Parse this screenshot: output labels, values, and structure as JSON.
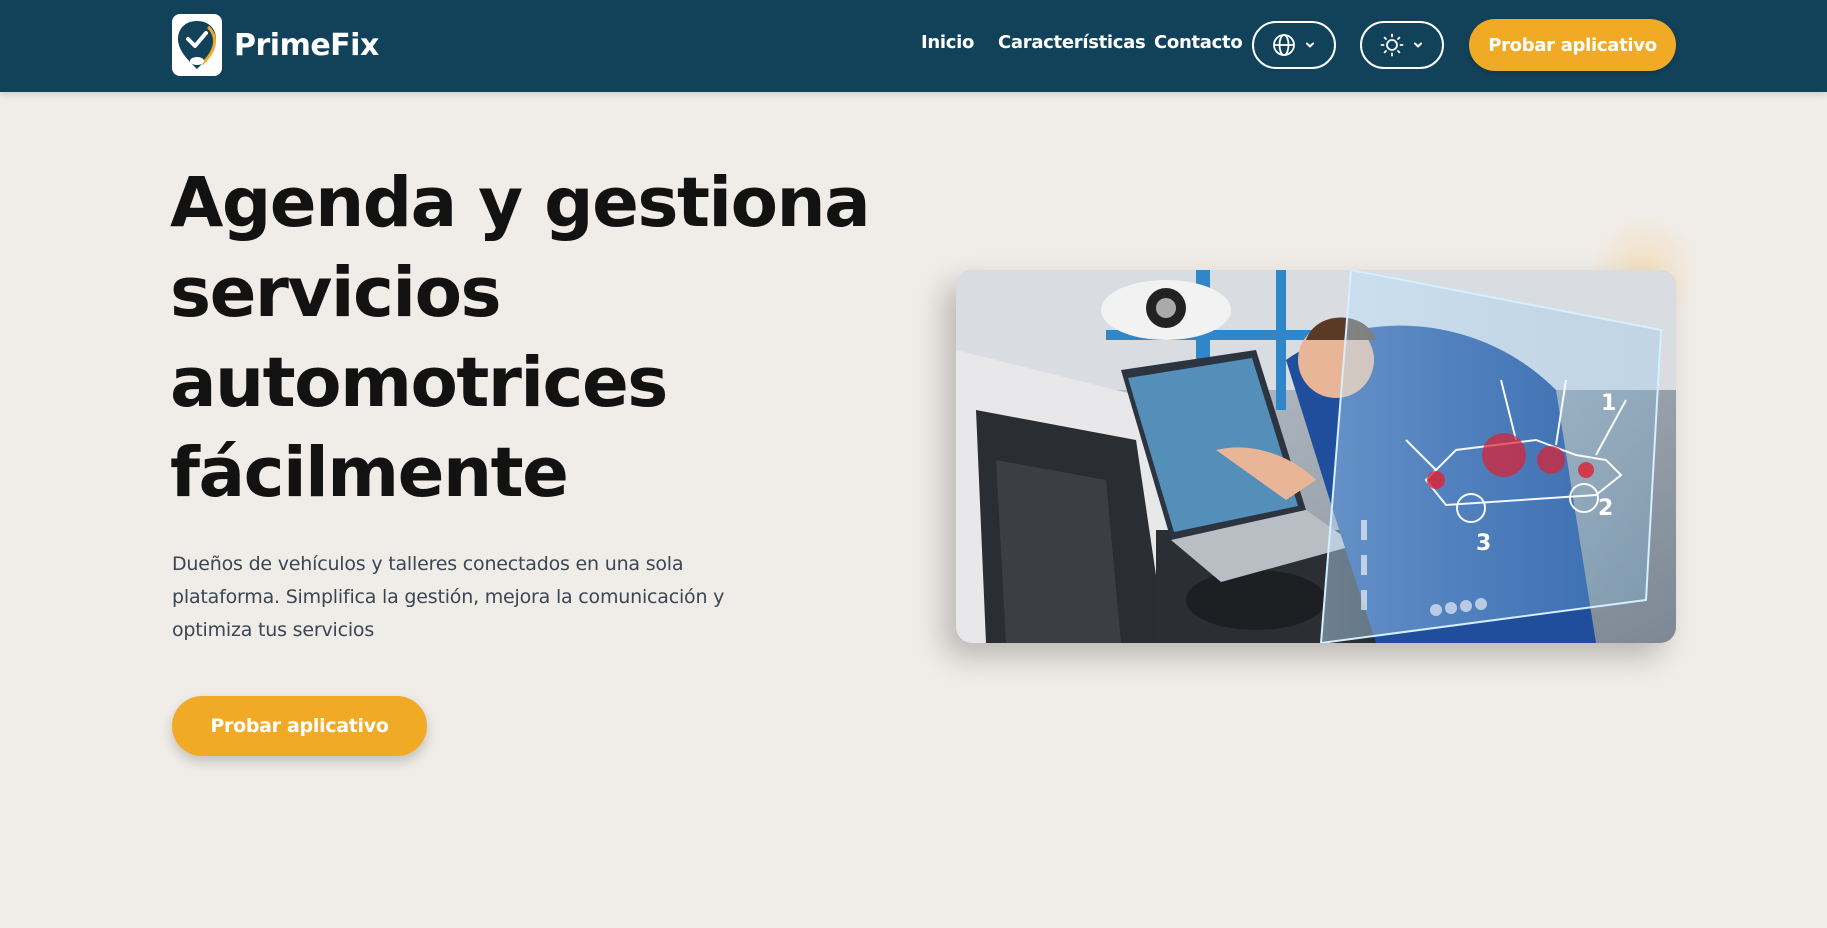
{
  "brand": {
    "name": "PrimeFix",
    "logo_icon": "check-map-pin-icon",
    "colors": {
      "navy": "#12425a",
      "accent": "#f1aa25"
    }
  },
  "nav": {
    "links": [
      "Inicio",
      "Características",
      "Contacto"
    ],
    "language_icon": "globe-icon",
    "theme_icon": "sun-icon",
    "cta_label": "Probar aplicativo"
  },
  "hero": {
    "title": "Agenda y gestiona servicios automotrices fácilmente",
    "description": "Dueños de vehículos y talleres conectados en una sola plataforma. Simplifica la gestión, mejora la comunicación y optimiza tus servicios",
    "cta_label": "Probar aplicativo",
    "image": {
      "subject": "mechanic-laptop-car-diagnostic-photo",
      "overlay_numbers": [
        "1",
        "2",
        "3"
      ]
    }
  }
}
